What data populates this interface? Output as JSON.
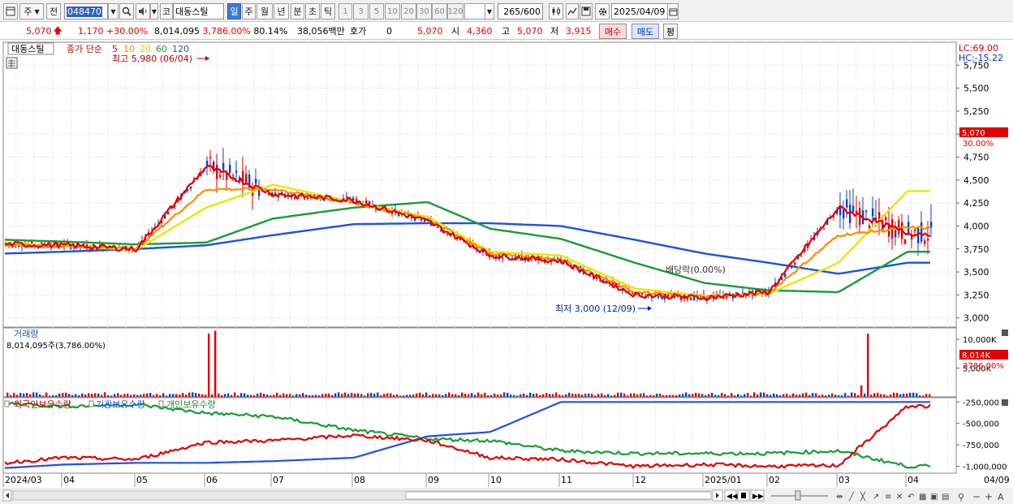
{
  "toolbar": {
    "market": "주",
    "prev_label": "전",
    "stock_code": "048470",
    "stock_type": "코",
    "stock_name": "대동스틸",
    "periods": [
      "일",
      "주",
      "월",
      "년",
      "분",
      "초",
      "틱"
    ],
    "active_period": "일",
    "intervals": [
      "1",
      "3",
      "5",
      "10",
      "20",
      "30",
      "60",
      "120"
    ],
    "count": "265",
    "count_max": "/600",
    "date": "2025/04/09"
  },
  "quote": {
    "price": "5,070",
    "change": "1,170",
    "change_pct": "+30.00%",
    "volume": "8,014,095",
    "volume_pct": "3,786.00%",
    "turnover": "80.14%",
    "amount": "38,056백만",
    "hoga_label": "호가",
    "hoga_value": "0",
    "bid_price": "5,070",
    "open_label": "시",
    "open": "4,360",
    "high_label": "고",
    "high": "5,070",
    "low_label": "저",
    "low": "3,915",
    "buy_label": "매수",
    "sell_label": "매도",
    "avg_label": "평"
  },
  "price_panel": {
    "title": "대동스틸",
    "ma_label": "종가 단순",
    "ma_periods": [
      "5",
      "10",
      "20",
      "60",
      "120"
    ],
    "ma_colors": [
      "#e00000",
      "#ff8c00",
      "#e8e800",
      "#1a9a3a",
      "#2050e0"
    ],
    "lc": "LC:69.00",
    "hc": "HC:-15.22",
    "high_note": "최고 5,980 (06/04)",
    "low_note": "최저 3,000 (12/09)",
    "dividend_note": "배당락(0.00%)",
    "price_tag": "5,070",
    "pct_tag": "30.00%",
    "y_ticks": [
      "5,750",
      "5,500",
      "5,250",
      "5,000",
      "4,750",
      "4,500",
      "4,250",
      "4,000",
      "3,750",
      "3,500",
      "3,250",
      "3,000"
    ]
  },
  "volume_panel": {
    "title": "거래량",
    "value_text": "8,014,095주(3,786.00%)",
    "y_ticks": [
      "10,000K",
      "5,000K"
    ],
    "tag": "8,014K",
    "pct_tag": "3786.00%"
  },
  "holdings_panel": {
    "series_labels": [
      "외국인보유수량",
      "기관보유수량",
      "개인보유수량"
    ],
    "series_colors": [
      "#e00000",
      "#2050e0",
      "#1a9a3a"
    ],
    "y_ticks": [
      "-250,000",
      "-500,000",
      "-750,000",
      "-1,000,000"
    ]
  },
  "x_axis": {
    "labels": [
      "2024/03",
      "04",
      "05",
      "06",
      "07",
      "08",
      "09",
      "10",
      "11",
      "12",
      "2025/01",
      "02",
      "03",
      "04",
      "04/09"
    ]
  },
  "chart_data": {
    "type": "line",
    "title": "",
    "x": [
      "2024/03",
      "04",
      "05",
      "06",
      "07",
      "08",
      "09",
      "10",
      "11",
      "12",
      "2025/01",
      "02",
      "03",
      "04"
    ],
    "ylim": [
      2900,
      6000
    ],
    "series": [
      {
        "name": "종가 단순 5",
        "values": [
          3800,
          3790,
          3750,
          4650,
          4350,
          4280,
          4050,
          3680,
          3620,
          3250,
          3220,
          3280,
          4200,
          3920
        ]
      },
      {
        "name": "종가 단순 10",
        "values": [
          3790,
          3780,
          3760,
          4400,
          4400,
          4250,
          4080,
          3700,
          3640,
          3280,
          3230,
          3270,
          3900,
          3980
        ]
      },
      {
        "name": "종가 단순 20",
        "values": [
          3820,
          3780,
          3740,
          4200,
          4450,
          4260,
          4100,
          3720,
          3680,
          3320,
          3240,
          3260,
          3600,
          4380
        ]
      },
      {
        "name": "종가 단순 60",
        "values": [
          3850,
          3830,
          3800,
          3820,
          4080,
          4200,
          4260,
          3970,
          3860,
          3600,
          3380,
          3300,
          3280,
          3720
        ]
      },
      {
        "name": "종가 단순 120",
        "values": [
          3700,
          3720,
          3750,
          3790,
          3900,
          4020,
          4030,
          4030,
          4000,
          3850,
          3700,
          3600,
          3480,
          3600
        ]
      }
    ]
  }
}
